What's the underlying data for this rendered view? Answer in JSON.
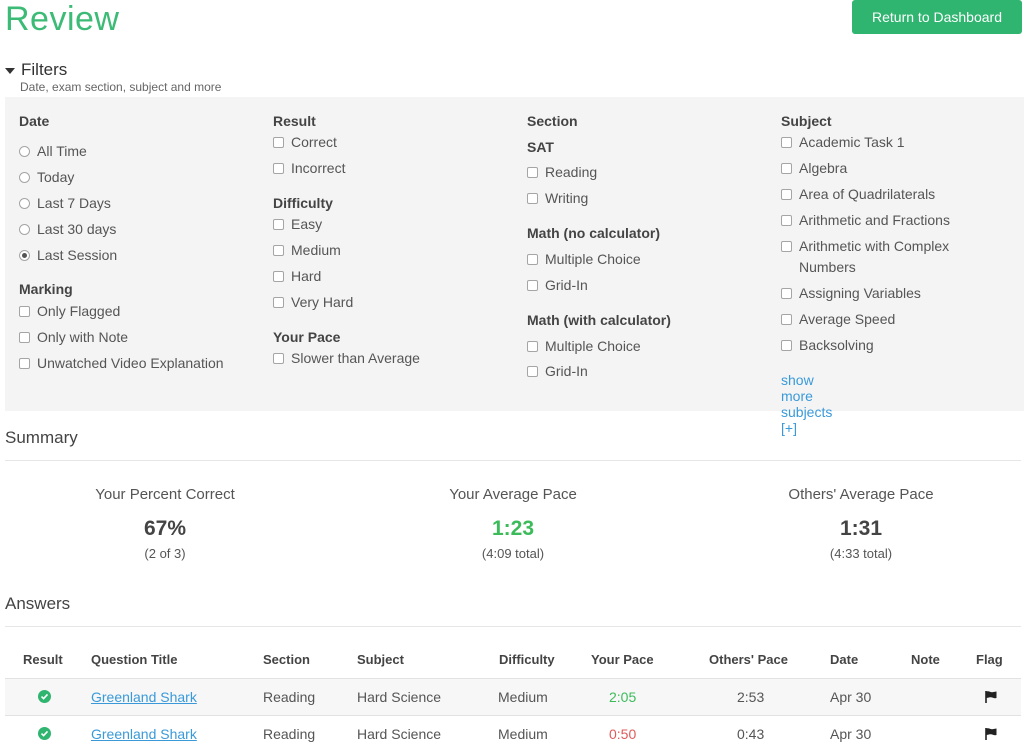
{
  "header": {
    "title": "Review",
    "return_button": "Return to Dashboard"
  },
  "filters": {
    "title": "Filters",
    "subtitle": "Date, exam section, subject and more",
    "date": {
      "label": "Date",
      "options": [
        "All Time",
        "Today",
        "Last 7 Days",
        "Last 30 days",
        "Last Session"
      ],
      "selected": "Last Session"
    },
    "marking": {
      "label": "Marking",
      "options": [
        "Only Flagged",
        "Only with Note",
        "Unwatched Video Explanation"
      ]
    },
    "result": {
      "label": "Result",
      "options": [
        "Correct",
        "Incorrect"
      ]
    },
    "difficulty": {
      "label": "Difficulty",
      "options": [
        "Easy",
        "Medium",
        "Hard",
        "Very Hard"
      ]
    },
    "pace": {
      "label": "Your Pace",
      "options": [
        "Slower than Average"
      ]
    },
    "section": {
      "label": "Section",
      "groups": [
        {
          "label": "SAT",
          "options": [
            "Reading",
            "Writing"
          ]
        },
        {
          "label": "Math (no calculator)",
          "options": [
            "Multiple Choice",
            "Grid-In"
          ]
        },
        {
          "label": "Math (with calculator)",
          "options": [
            "Multiple Choice",
            "Grid-In"
          ]
        }
      ]
    },
    "subject": {
      "label": "Subject",
      "options": [
        "Academic Task 1",
        "Algebra",
        "Area of Quadrilaterals",
        "Arithmetic and Fractions",
        "Arithmetic with Complex Numbers",
        "Assigning Variables",
        "Average Speed",
        "Backsolving"
      ],
      "more_link": "show more subjects [+]"
    }
  },
  "summary": {
    "title": "Summary",
    "percent_correct": {
      "label": "Your Percent Correct",
      "value": "67%",
      "sub": "(2 of 3)"
    },
    "average_pace": {
      "label": "Your Average Pace",
      "value": "1:23",
      "sub": "(4:09 total)"
    },
    "others_pace": {
      "label": "Others' Average Pace",
      "value": "1:31",
      "sub": "(4:33 total)"
    }
  },
  "answers": {
    "title": "Answers",
    "columns": [
      "Result",
      "Question Title",
      "Section",
      "Subject",
      "Difficulty",
      "Your Pace",
      "Others' Pace",
      "Date",
      "Note",
      "Flag"
    ],
    "rows": [
      {
        "result": "correct",
        "question": "Greenland Shark",
        "section": "Reading",
        "subject": "Hard Science",
        "difficulty": "Medium",
        "your_pace": "2:05",
        "others_pace": "2:53",
        "date": "Apr 30",
        "note": "",
        "flagged": true
      },
      {
        "result": "correct",
        "question": "Greenland Shark",
        "section": "Reading",
        "subject": "Hard Science",
        "difficulty": "Medium",
        "your_pace": "0:50",
        "others_pace": "0:43",
        "date": "Apr 30",
        "note": "",
        "flagged": true
      }
    ]
  },
  "colors": {
    "accent": "#3cbb76",
    "button": "#2fb56f",
    "link": "#3a9ad9",
    "pace_fast": "#3cbb5a",
    "pace_slow": "#e05a5a"
  }
}
